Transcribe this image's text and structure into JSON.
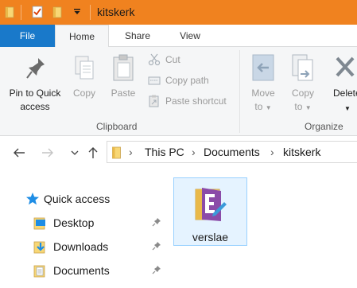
{
  "window": {
    "title": "kitskerk",
    "accent_color": "#f0821f",
    "quick_access_icons": [
      "folder-icon",
      "properties-icon",
      "new-folder-icon",
      "customize-dropdown-icon"
    ]
  },
  "tabs": {
    "file": "File",
    "home": "Home",
    "share": "Share",
    "view": "View",
    "active": "Home"
  },
  "ribbon": {
    "clipboard": {
      "pin_line1": "Pin to Quick",
      "pin_line2": "access",
      "copy": "Copy",
      "paste": "Paste",
      "cut": "Cut",
      "copy_path": "Copy path",
      "paste_shortcut": "Paste shortcut",
      "group_label": "Clipboard"
    },
    "organize": {
      "move_line1": "Move",
      "move_line2": "to",
      "copy_line1": "Copy",
      "copy_line2": "to",
      "delete_label": "Delete",
      "group_label": "Organize"
    }
  },
  "address": {
    "crumbs": [
      "This PC",
      "Documents",
      "kitskerk"
    ]
  },
  "nav_pane": {
    "quick_access": "Quick access",
    "items": [
      {
        "label": "Desktop",
        "icon": "desktop-folder-icon",
        "pinned": true
      },
      {
        "label": "Downloads",
        "icon": "downloads-folder-icon",
        "pinned": true
      },
      {
        "label": "Documents",
        "icon": "documents-folder-icon",
        "pinned": true
      }
    ]
  },
  "files": [
    {
      "name": "verslae",
      "icon": "folder-icon",
      "selected": true
    }
  ]
}
